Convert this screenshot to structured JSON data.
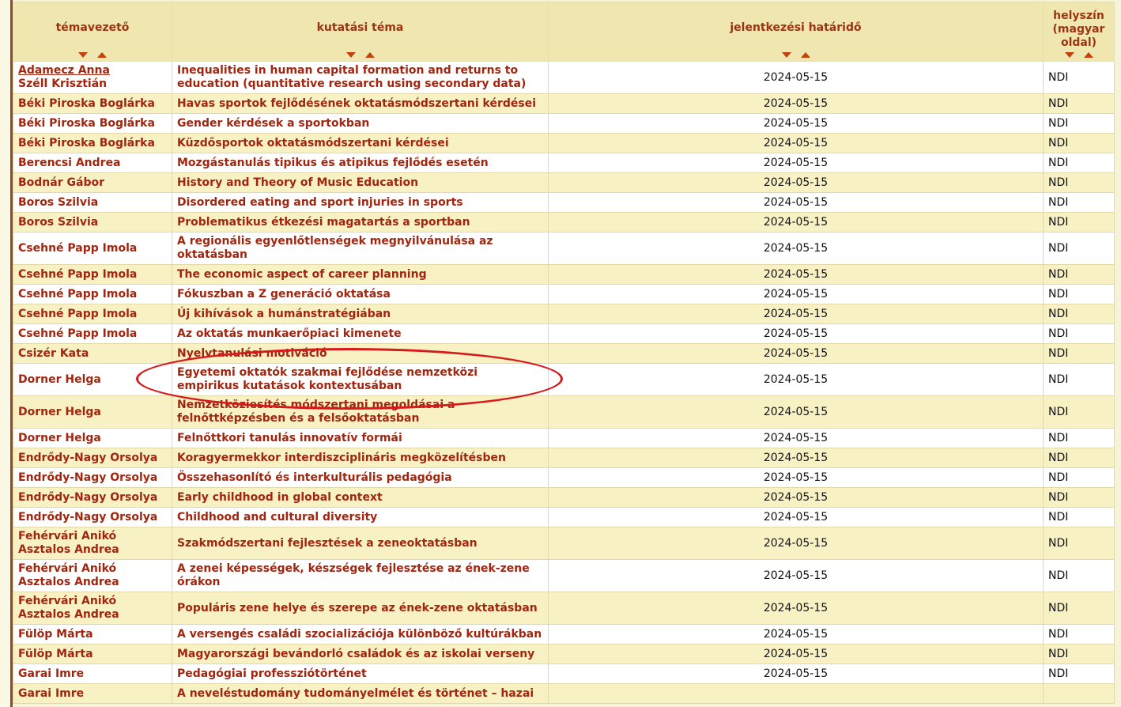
{
  "headers": {
    "supervisor": "témavezető",
    "topic": "kutatási téma",
    "deadline": "jelentkezési határidő",
    "place": "helyszín (magyar oldal)"
  },
  "rows": [
    {
      "supervisors": [
        "Adamecz Anna",
        "Széll Krisztián"
      ],
      "topic": "Inequalities in human capital formation and returns to education (quantitative research using secondary data)",
      "deadline": "2024-05-15",
      "place": "NDI"
    },
    {
      "supervisors": [
        "Béki Piroska Boglárka"
      ],
      "topic": "Havas sportok fejlődésének oktatásmódszertani kérdései",
      "deadline": "2024-05-15",
      "place": "NDI"
    },
    {
      "supervisors": [
        "Béki Piroska Boglárka"
      ],
      "topic": "Gender kérdések a sportokban",
      "deadline": "2024-05-15",
      "place": "NDI"
    },
    {
      "supervisors": [
        "Béki Piroska Boglárka"
      ],
      "topic": "Küzdősportok oktatásmódszertani kérdései",
      "deadline": "2024-05-15",
      "place": "NDI"
    },
    {
      "supervisors": [
        "Berencsi Andrea"
      ],
      "topic": "Mozgástanulás tipikus és atipikus fejlődés esetén",
      "deadline": "2024-05-15",
      "place": "NDI"
    },
    {
      "supervisors": [
        "Bodnár Gábor"
      ],
      "topic": "History and Theory of Music Education",
      "deadline": "2024-05-15",
      "place": "NDI"
    },
    {
      "supervisors": [
        "Boros Szilvia"
      ],
      "topic": "Disordered eating and sport injuries in sports",
      "deadline": "2024-05-15",
      "place": "NDI"
    },
    {
      "supervisors": [
        "Boros Szilvia"
      ],
      "topic": "Problematikus étkezési magatartás a sportban",
      "deadline": "2024-05-15",
      "place": "NDI"
    },
    {
      "supervisors": [
        "Csehné Papp Imola"
      ],
      "topic": "A regionális egyenlőtlenségek megnyilvánulása az oktatásban",
      "deadline": "2024-05-15",
      "place": "NDI"
    },
    {
      "supervisors": [
        "Csehné Papp Imola"
      ],
      "topic": "The economic aspect of career planning",
      "deadline": "2024-05-15",
      "place": "NDI"
    },
    {
      "supervisors": [
        "Csehné Papp Imola"
      ],
      "topic": "Fókuszban a Z generáció oktatása",
      "deadline": "2024-05-15",
      "place": "NDI"
    },
    {
      "supervisors": [
        "Csehné Papp Imola"
      ],
      "topic": "Új kihívások a humánstratégiában",
      "deadline": "2024-05-15",
      "place": "NDI"
    },
    {
      "supervisors": [
        "Csehné Papp Imola"
      ],
      "topic": "Az oktatás munkaerőpiaci kimenete",
      "deadline": "2024-05-15",
      "place": "NDI"
    },
    {
      "supervisors": [
        "Csizér Kata"
      ],
      "topic": "Nyelvtanulási motiváció",
      "deadline": "2024-05-15",
      "place": "NDI"
    },
    {
      "supervisors": [
        "Dorner Helga"
      ],
      "topic": "Egyetemi oktatók szakmai fejlődése nemzetközi empirikus kutatások kontextusában",
      "deadline": "2024-05-15",
      "place": "NDI"
    },
    {
      "supervisors": [
        "Dorner Helga"
      ],
      "topic": "Nemzetköziesítés módszertani megoldásai a felnőttképzésben és a felsőoktatásban",
      "deadline": "2024-05-15",
      "place": "NDI"
    },
    {
      "supervisors": [
        "Dorner Helga"
      ],
      "topic": "Felnőttkori tanulás innovatív formái",
      "deadline": "2024-05-15",
      "place": "NDI"
    },
    {
      "supervisors": [
        "Endrődy-Nagy Orsolya"
      ],
      "topic": "Koragyermekkor interdiszciplináris megközelítésben",
      "deadline": "2024-05-15",
      "place": "NDI"
    },
    {
      "supervisors": [
        "Endrődy-Nagy Orsolya"
      ],
      "topic": "Összehasonlító és interkulturális pedagógia",
      "deadline": "2024-05-15",
      "place": "NDI"
    },
    {
      "supervisors": [
        "Endrődy-Nagy Orsolya"
      ],
      "topic": "Early childhood in global context",
      "deadline": "2024-05-15",
      "place": "NDI"
    },
    {
      "supervisors": [
        "Endrődy-Nagy Orsolya"
      ],
      "topic": "Childhood and cultural diversity",
      "deadline": "2024-05-15",
      "place": "NDI"
    },
    {
      "supervisors": [
        "Fehérvári Anikó",
        "Asztalos Andrea"
      ],
      "topic": "Szakmódszertani fejlesztések a zeneoktatásban",
      "deadline": "2024-05-15",
      "place": "NDI"
    },
    {
      "supervisors": [
        "Fehérvári Anikó",
        "Asztalos Andrea"
      ],
      "topic": "A zenei képességek, készségek fejlesztése az ének-zene órákon",
      "deadline": "2024-05-15",
      "place": "NDI"
    },
    {
      "supervisors": [
        "Fehérvári Anikó",
        "Asztalos Andrea"
      ],
      "topic": "Populáris zene helye és szerepe az ének-zene oktatásban",
      "deadline": "2024-05-15",
      "place": "NDI"
    },
    {
      "supervisors": [
        "Fülöp Márta"
      ],
      "topic": "A versengés családi szocializációja különböző kultúrákban",
      "deadline": "2024-05-15",
      "place": "NDI"
    },
    {
      "supervisors": [
        "Fülöp Márta"
      ],
      "topic": "Magyarországi bevándorló családok és az iskolai verseny",
      "deadline": "2024-05-15",
      "place": "NDI"
    },
    {
      "supervisors": [
        "Garai Imre"
      ],
      "topic": "Pedagógiai professziótörténet",
      "deadline": "2024-05-15",
      "place": "NDI"
    },
    {
      "supervisors": [
        "Garai Imre"
      ],
      "topic": "A neveléstudomány tudományelmélet és történet – hazai",
      "deadline": "",
      "place": ""
    }
  ]
}
